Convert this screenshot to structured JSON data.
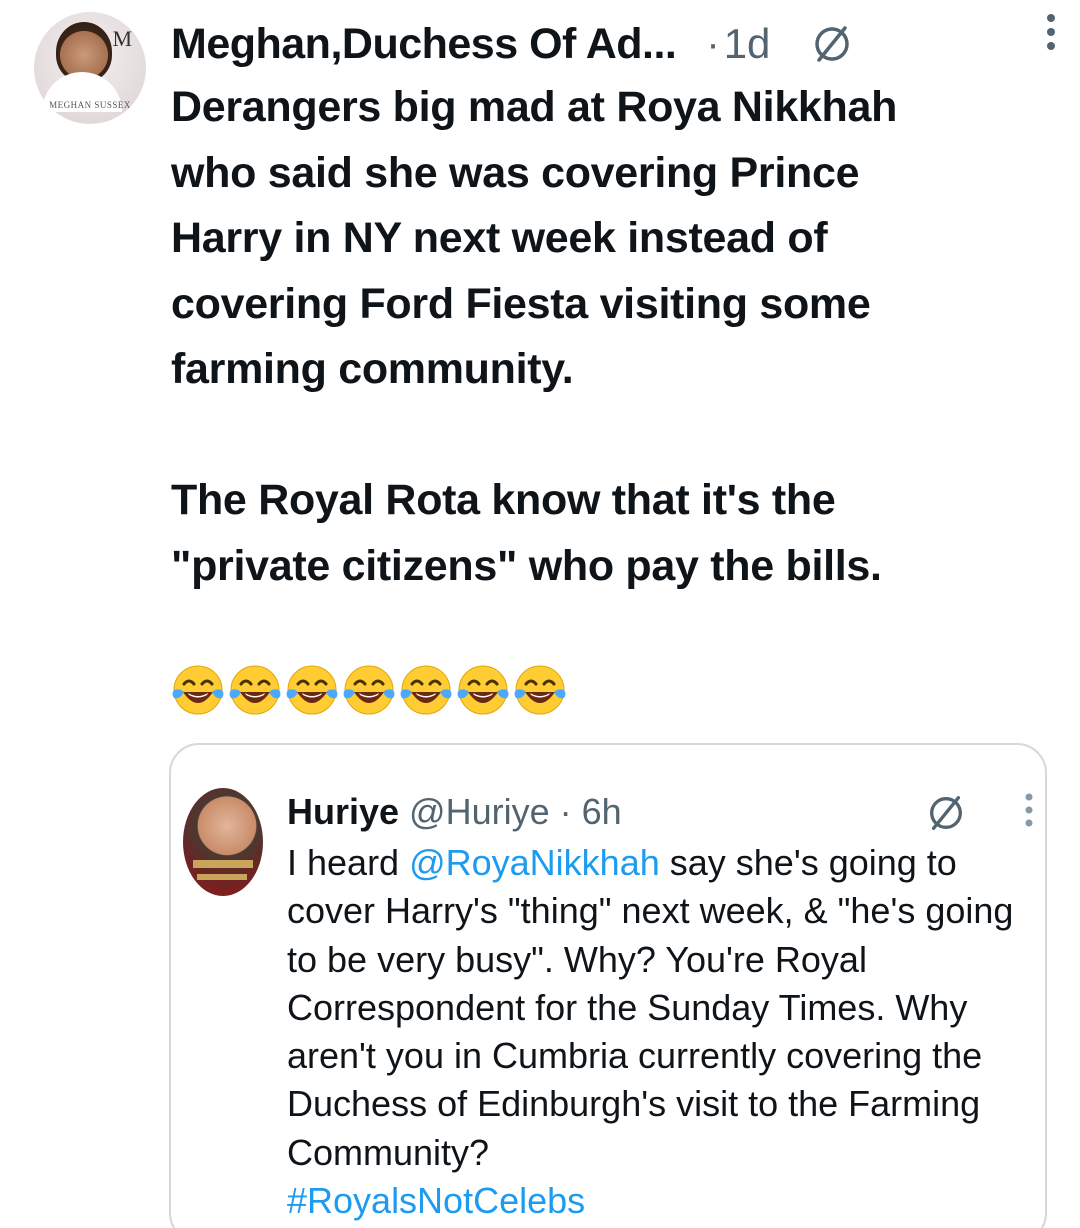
{
  "post": {
    "author": {
      "name": "Meghan,Duchess Of Ad...",
      "avatar_monogram": "M",
      "avatar_caption": "MEGHAN SUSSEX"
    },
    "separator": "·",
    "time": "1d",
    "icons": {
      "grok": "slashed-circle-icon",
      "more": "vertical-dots-icon"
    },
    "text": "Derangers big mad at Roya Nikkhah\nwho said she was covering Prince\nHarry  in NY next week instead of\ncovering Ford Fiesta visiting some\nfarming community.\n\nThe Royal Rota know that it's the\n\"private citizens\" who pay the bills.",
    "emoji_count": 7,
    "emoji_name": "face-with-tears-of-joy"
  },
  "quote": {
    "author_name": "Huriye",
    "handle": "@Huriye",
    "separator": "·",
    "time": "6h",
    "text_before": "I heard ",
    "mention": "@RoyaNikkhah",
    "text_after": " say she's going to cover Harry's \"thing\" next week, & \"he's going to be very busy\". Why? You're Royal Correspondent for the Sunday Times. Why aren't you in Cumbria currently covering the Duchess of Edinburgh's visit to the Farming Community?",
    "hashtag": "#RoyalsNotCelebs"
  },
  "colors": {
    "text": "#0f1419",
    "secondary": "#536471",
    "link": "#1d9bf0",
    "border": "#cfd9de"
  }
}
